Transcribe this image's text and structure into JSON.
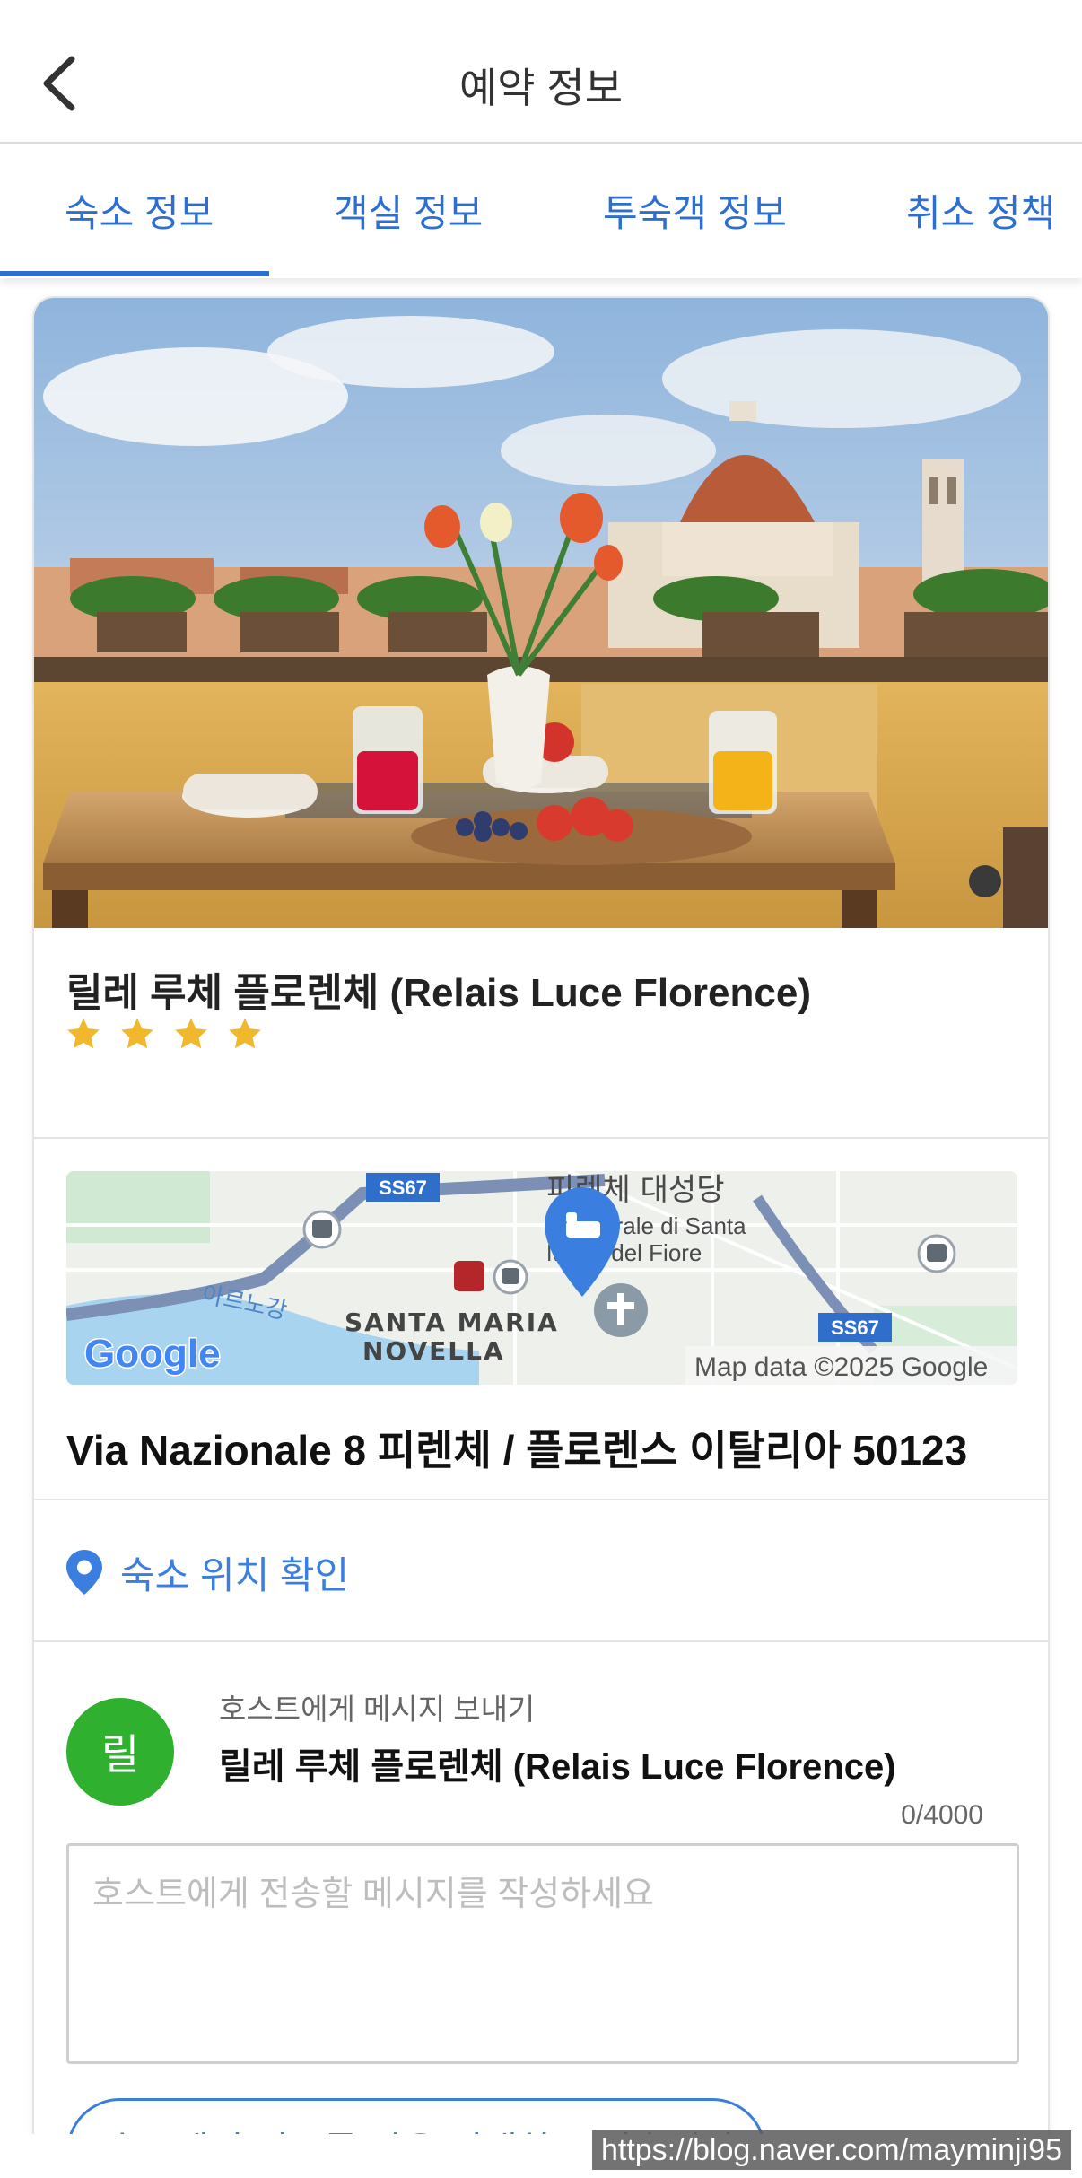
{
  "header": {
    "title": "예약 정보"
  },
  "tabs": [
    {
      "label": "숙소 정보"
    },
    {
      "label": "객실 정보"
    },
    {
      "label": "투숙객 정보"
    },
    {
      "label": "취소 정책"
    }
  ],
  "hotel": {
    "name": "릴레 루체 플로렌체 (Relais Luce Florence)",
    "star_rating": 4,
    "address": "Via Nazionale 8 피렌체 / 플로렌스 이탈리아 50123"
  },
  "map": {
    "road_label_top": "SS67",
    "road_label_bottom": "SS67",
    "landmark_ko": "피렌체 대성당",
    "landmark_it_line1": "Cattedrale di Santa",
    "landmark_it_line2": "Maria del Fiore",
    "river_label": "아르노강",
    "district_line1": "SANTA MARIA",
    "district_line2": "NOVELLA",
    "logo_text": "Google",
    "attribution": "Map data ©2025 Google"
  },
  "location": {
    "link_label": "숙소 위치 확인"
  },
  "message": {
    "heading": "호스트에게 메시지 보내기",
    "avatar_initial": "릴",
    "host_name": "릴레 루체 플로렌체 (Relais Luce Florence)",
    "counter": "0/4000",
    "placeholder": "호스트에게 전송할 메시지를 작성하세요",
    "quick_reply": "숙소에서 미모를 남은 기대하고 있습니다!"
  },
  "watermark": "https://blog.naver.com/mayminji95",
  "colors": {
    "accent": "#2d6fd1",
    "star": "#f1b82d",
    "avatar": "#2fb12f"
  }
}
